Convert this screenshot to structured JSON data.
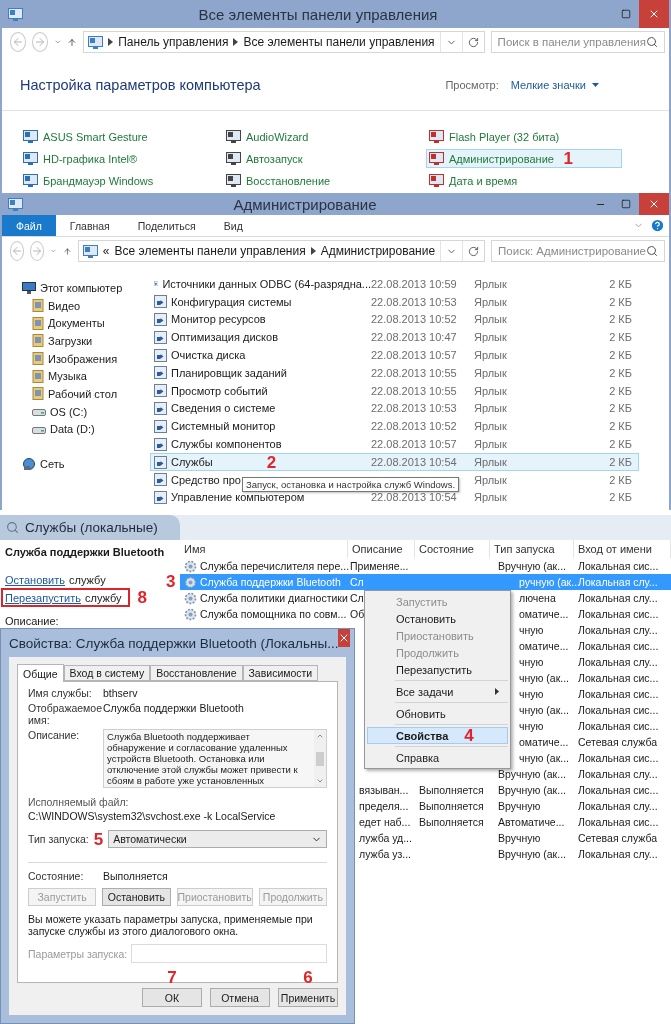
{
  "control_panel": {
    "title": "Все элементы панели управления",
    "path": [
      "Панель управления",
      "Все элементы панели управления"
    ],
    "search_placeholder": "Поиск в панели управления",
    "heading": "Настройка параметров компьютера",
    "view_label": "Просмотр:",
    "view_value": "Мелкие значки",
    "items": [
      {
        "label": "ASUS Smart Gesture",
        "selected": false
      },
      {
        "label": "AudioWizard",
        "selected": false
      },
      {
        "label": "Flash Player (32 бита)",
        "selected": false
      },
      {
        "label": "HD-графика Intel®",
        "selected": false
      },
      {
        "label": "Автозапуск",
        "selected": false
      },
      {
        "label": "Администрирование",
        "selected": true,
        "marker": "1"
      },
      {
        "label": "Брандмауэр Windows",
        "selected": false
      },
      {
        "label": "Восстановление",
        "selected": false
      },
      {
        "label": "Дата и время",
        "selected": false
      }
    ]
  },
  "admin_window": {
    "title": "Администрирование",
    "ribbon_tabs": [
      {
        "label": "Файл",
        "selected": true
      },
      {
        "label": "Главная",
        "selected": false
      },
      {
        "label": "Поделиться",
        "selected": false
      },
      {
        "label": "Вид",
        "selected": false
      }
    ],
    "path_prefix": "«",
    "path": [
      "Все элементы панели управления",
      "Администрирование"
    ],
    "search_placeholder": "Поиск: Администрирование",
    "nav": [
      {
        "label": "Этот компьютер",
        "kind": "computer",
        "children": [
          {
            "label": "Видео",
            "kind": "folder"
          },
          {
            "label": "Документы",
            "kind": "folder"
          },
          {
            "label": "Загрузки",
            "kind": "folder"
          },
          {
            "label": "Изображения",
            "kind": "folder"
          },
          {
            "label": "Музыка",
            "kind": "folder"
          },
          {
            "label": "Рабочий стол",
            "kind": "folder"
          },
          {
            "label": "OS (C:)",
            "kind": "drive"
          },
          {
            "label": "Data (D:)",
            "kind": "drive"
          }
        ]
      },
      {
        "label": "Сеть",
        "kind": "network"
      }
    ],
    "files": [
      {
        "name": "Источники данных ODBC (64-разрядна...",
        "date": "22.08.2013 10:59",
        "type": "Ярлык",
        "size": "2 КБ",
        "selected": false
      },
      {
        "name": "Конфигурация системы",
        "date": "22.08.2013 10:53",
        "type": "Ярлык",
        "size": "2 КБ",
        "selected": false
      },
      {
        "name": "Монитор ресурсов",
        "date": "22.08.2013 10:52",
        "type": "Ярлык",
        "size": "2 КБ",
        "selected": false
      },
      {
        "name": "Оптимизация дисков",
        "date": "22.08.2013 10:47",
        "type": "Ярлык",
        "size": "2 КБ",
        "selected": false
      },
      {
        "name": "Очистка диска",
        "date": "22.08.2013 10:57",
        "type": "Ярлык",
        "size": "2 КБ",
        "selected": false
      },
      {
        "name": "Планировщик заданий",
        "date": "22.08.2013 10:55",
        "type": "Ярлык",
        "size": "2 КБ",
        "selected": false
      },
      {
        "name": "Просмотр событий",
        "date": "22.08.2013 10:55",
        "type": "Ярлык",
        "size": "2 КБ",
        "selected": false
      },
      {
        "name": "Сведения о системе",
        "date": "22.08.2013 10:53",
        "type": "Ярлык",
        "size": "2 КБ",
        "selected": false
      },
      {
        "name": "Системный монитор",
        "date": "22.08.2013 10:52",
        "type": "Ярлык",
        "size": "2 КБ",
        "selected": false
      },
      {
        "name": "Службы компонентов",
        "date": "22.08.2013 10:57",
        "type": "Ярлык",
        "size": "2 КБ",
        "selected": false
      },
      {
        "name": "Службы",
        "date": "22.08.2013 10:54",
        "type": "Ярлык",
        "size": "2 КБ",
        "selected": true,
        "marker": "2"
      },
      {
        "name": "Средство про",
        "type": "Ярлык",
        "size": "2 КБ",
        "selected": false
      },
      {
        "name": "Управление компьютером",
        "date": "22.08.2013 10:54",
        "type": "Ярлык",
        "size": "2 КБ",
        "selected": false
      }
    ],
    "tooltip": "Запуск, остановка и настройка служб Windows."
  },
  "services_window": {
    "title": "Службы (локальные)",
    "detail_title": "Служба поддержки Bluetooth",
    "actions": [
      {
        "link": "Остановить",
        "rest": "службу"
      },
      {
        "link": "Перезапустить",
        "rest": "службу",
        "marker": "8"
      }
    ],
    "description_label": "Описание:",
    "columns": [
      "Имя",
      "Описание",
      "Состояние",
      "Тип запуска",
      "Вход от имени"
    ],
    "rows": [
      {
        "kind": "full",
        "name": "Служба перечислителя пере...",
        "description": "Применяе...",
        "start_type": "Вручную (ак...",
        "logon": "Локальная сис...",
        "selected": false
      },
      {
        "kind": "menu",
        "name": "Служба поддержки Bluetooth",
        "description": "Сл",
        "start_type": "ручную (ак...",
        "logon": "Локальная слу...",
        "selected": true,
        "marker": "3"
      },
      {
        "kind": "menu",
        "name": "Служба политики диагностики",
        "description": "Сл",
        "start_type": "лючена",
        "logon": "Локальная слу...",
        "selected": false
      },
      {
        "kind": "menu",
        "name": "Служба помощника по совм...",
        "description": "Об",
        "start_type": "оматиче...",
        "logon": "Локальная сис...",
        "selected": false
      },
      {
        "kind": "menu",
        "start_type": "чную",
        "logon": "Локальная слу...",
        "selected": false
      },
      {
        "kind": "menu",
        "start_type": "оматиче...",
        "logon": "Локальная сис...",
        "selected": false
      },
      {
        "kind": "menu",
        "start_type": "чную",
        "logon": "Локальная слу...",
        "selected": false
      },
      {
        "kind": "menu",
        "start_type": "чную (ак...",
        "logon": "Локальная сис...",
        "selected": false
      },
      {
        "kind": "menu",
        "start_type": "чную",
        "logon": "Локальная сис...",
        "selected": false
      },
      {
        "kind": "menu",
        "start_type": "чную (ак...",
        "logon": "Локальная сис...",
        "selected": false
      },
      {
        "kind": "menu",
        "start_type": "чную",
        "logon": "Локальная сис...",
        "selected": false
      },
      {
        "kind": "menu",
        "start_type": "оматиче...",
        "logon": "Сетевая служба",
        "selected": false
      },
      {
        "kind": "menu",
        "start_type": "чную (ак...",
        "logon": "Локальная сис...",
        "selected": false
      },
      {
        "kind": "dialog",
        "start_type": "Вручную (ак...",
        "logon": "Локальная слу...",
        "selected": false
      },
      {
        "kind": "dialog",
        "description": "вязыван...",
        "state": "Выполняется",
        "start_type": "Вручную (ак...",
        "logon": "Локальная сис...",
        "selected": false
      },
      {
        "kind": "dialog",
        "description": "пределя...",
        "state": "Выполняется",
        "start_type": "Вручную",
        "logon": "Локальная слу...",
        "selected": false
      },
      {
        "kind": "dialog",
        "description": "едет наб...",
        "state": "Выполняется",
        "start_type": "Автоматиче...",
        "logon": "Локальная сис...",
        "selected": false
      },
      {
        "kind": "dialog",
        "description": "лужба уд...",
        "start_type": "Вручную",
        "logon": "Сетевая служба",
        "selected": false
      },
      {
        "kind": "dialog",
        "description": "лужба уз...",
        "start_type": "Вручную (ак...",
        "logon": "Локальная слу...",
        "selected": false
      }
    ],
    "context_menu": [
      {
        "label": "Запустить",
        "disabled": true,
        "selected": false
      },
      {
        "label": "Остановить",
        "disabled": false,
        "selected": false
      },
      {
        "label": "Приостановить",
        "disabled": true,
        "selected": false
      },
      {
        "label": "Продолжить",
        "disabled": true,
        "selected": false
      },
      {
        "label": "Перезапустить",
        "disabled": false,
        "selected": false
      },
      {
        "label": "Все задачи",
        "disabled": false,
        "selected": false,
        "separator_before": true,
        "submenu": true
      },
      {
        "label": "Обновить",
        "disabled": false,
        "selected": false,
        "separator_before": true
      },
      {
        "label": "Свойства",
        "disabled": false,
        "selected": true,
        "separator_before": true,
        "marker": "4"
      },
      {
        "label": "Справка",
        "disabled": false,
        "selected": false,
        "separator_before": true
      }
    ]
  },
  "properties_dialog": {
    "title": "Свойства: Служба поддержки Bluetooth (Локальны...",
    "tabs": [
      {
        "label": "Общие",
        "selected": true
      },
      {
        "label": "Вход в систему",
        "selected": false
      },
      {
        "label": "Восстановление",
        "selected": false
      },
      {
        "label": "Зависимости",
        "selected": false
      }
    ],
    "service_name_label": "Имя службы:",
    "service_name": "bthserv",
    "display_name_label": "Отображаемое имя:",
    "display_name": "Служба поддержки Bluetooth",
    "description_label": "Описание:",
    "description": "Служба Bluetooth поддерживает обнаружение и согласование удаленных устройств Bluetooth. Остановка или отключение этой службы может привести к сбоям в работе уже установленных",
    "executable_label": "Исполняемый файл:",
    "executable": "C:\\WINDOWS\\system32\\svchost.exe -k LocalService",
    "startup_label": "Тип запуска:",
    "startup_marker": "5",
    "startup_value": "Автоматически",
    "status_label": "Состояние:",
    "status_value": "Выполняется",
    "service_buttons": [
      {
        "label": "Запустить",
        "disabled": true
      },
      {
        "label": "Остановить",
        "disabled": false
      },
      {
        "label": "Приостановить",
        "disabled": true
      },
      {
        "label": "Продолжить",
        "disabled": true
      }
    ],
    "hint": "Вы можете указать параметры запуска, применяемые при запуске службы из этого диалогового окна.",
    "params_label": "Параметры запуска:",
    "footer_buttons": [
      {
        "label": "ОК",
        "marker": "7"
      },
      {
        "label": "Отмена"
      },
      {
        "label": "Применить",
        "marker": "6"
      }
    ]
  }
}
